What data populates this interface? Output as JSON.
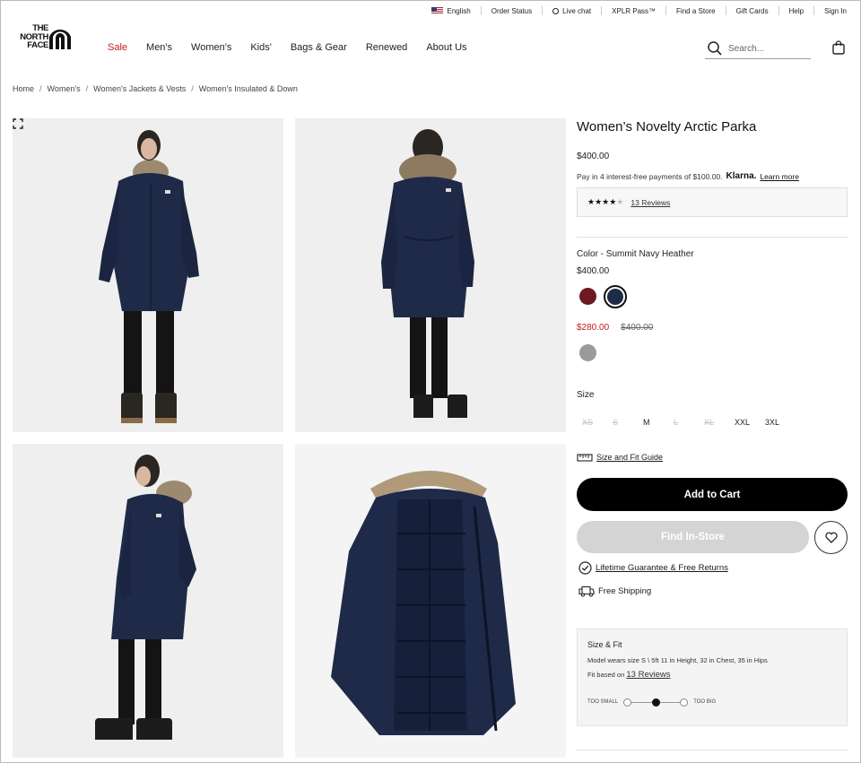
{
  "utility_bar": {
    "language": "English",
    "order_status": "Order Status",
    "live_chat": "Live chat",
    "xplr_pass": "XPLR Pass™",
    "find_store": "Find a Store",
    "gift_cards": "Gift Cards",
    "help": "Help",
    "sign_in": "Sign In"
  },
  "logo": {
    "line1": "THE",
    "line2": "NORTH",
    "line3": "FACE"
  },
  "nav": {
    "sale": "Sale",
    "mens": "Men's",
    "womens": "Women's",
    "kids": "Kids'",
    "bags_gear": "Bags & Gear",
    "renewed": "Renewed",
    "about": "About Us",
    "sale_color": "#c21c1c"
  },
  "search": {
    "placeholder": "Search..."
  },
  "breadcrumb": [
    "Home",
    "Women's",
    "Women's Jackets & Vests",
    "Women's Insulated & Down"
  ],
  "product": {
    "title": "Women’s Novelty Arctic Parka",
    "price": "$400.00",
    "klarna_text": "Pay in 4 interest-free payments of $100.00.",
    "klarna_brand": "Klarna.",
    "klarna_link": "Learn more",
    "rating": 4,
    "rating_max": 5,
    "reviews_link": "13 Reviews",
    "color_label": "Color - Summit Navy Heather",
    "color_price": "$400.00",
    "swatches": [
      {
        "name": "burgundy",
        "color": "#6e1a22"
      },
      {
        "name": "summit-navy-heather",
        "color": "#1f2a48",
        "selected": true
      },
      {
        "name": "grey",
        "color": "#9a9a9a"
      }
    ],
    "sale_price": "$280.00",
    "original_price": "$400.00",
    "size_label": "Size",
    "sizes": [
      {
        "label": "XS",
        "available": false
      },
      {
        "label": "S",
        "available": false
      },
      {
        "label": "M",
        "available": true
      },
      {
        "label": "L",
        "available": false
      },
      {
        "label": "XL",
        "available": false
      },
      {
        "label": "XXL",
        "available": true
      },
      {
        "label": "3XL",
        "available": true
      }
    ],
    "fit_guide": "Size and Fit Guide",
    "add_to_cart": "Add to Cart",
    "find_in_store": "Find In-Store",
    "guarantee": "Lifetime Guarantee & Free Returns",
    "shipping": "Free Shipping"
  },
  "size_fit": {
    "title": "Size & Fit",
    "model_text": "Model wears size S \\ 5ft 11 in Height, 32 in Chest, 35 in Hips",
    "fit_based_prefix": "Fit based on",
    "fit_based_link": "13 Reviews",
    "too_small": "TOO SMALL",
    "too_big": "TOO BIG",
    "fit_position": 0.5
  }
}
